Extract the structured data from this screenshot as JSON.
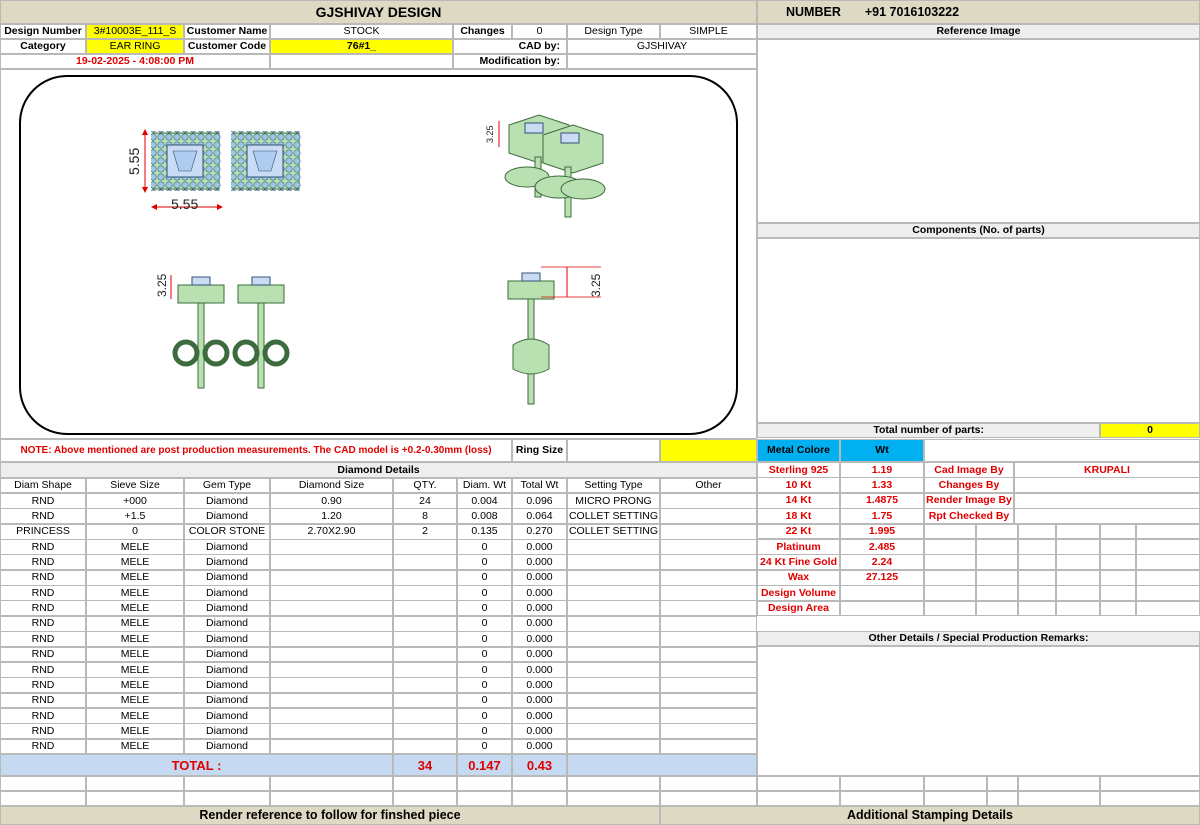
{
  "header": {
    "title": "GJSHIVAY DESIGN",
    "number_label": "NUMBER",
    "number_value": "+91 7016103222"
  },
  "info": {
    "design_number_label": "Design Number",
    "design_number": "3#10003E_111_S",
    "customer_name_label": "Customer Name",
    "customer_name": "STOCK",
    "changes_label": "Changes",
    "changes": "0",
    "design_type_label": "Design Type",
    "design_type": "SIMPLE",
    "category_label": "Category",
    "category": "EAR RING",
    "customer_code_label": "Customer Code",
    "customer_code": "76#1_",
    "cad_by_label": "CAD by:",
    "cad_by": "GJSHIVAY",
    "date": "19-02-2025 - 4:08:00 PM",
    "modification_label": "Modification by:"
  },
  "drawing": {
    "dim_width": "5.55",
    "dim_height": "5.55",
    "dim_side": "3.25",
    "dim_front": "3.25",
    "dim_persp": "3.25"
  },
  "right_panel": {
    "reference_image_label": "Reference Image",
    "components_label": "Components (No. of parts)",
    "total_parts_label": "Total number of parts:",
    "total_parts": "0",
    "other_details_label": "Other Details / Special Production Remarks:",
    "additional_stamping": "Additional Stamping Details"
  },
  "note": {
    "text": "NOTE: Above mentioned are post production measurements. The CAD model is +0.2-0.30mm (loss)",
    "ring_size_label": "Ring Size"
  },
  "diamond": {
    "section_title": "Diamond Details",
    "headers": [
      "Diam Shape",
      "Sieve Size",
      "Gem Type",
      "Diamond Size",
      "QTY.",
      "Diam. Wt",
      "Total Wt",
      "Setting Type",
      "Other"
    ],
    "rows": [
      [
        "RND",
        "+000",
        "Diamond",
        "0.90",
        "24",
        "0.004",
        "0.096",
        "MICRO PRONG",
        ""
      ],
      [
        "RND",
        "+1.5",
        "Diamond",
        "1.20",
        "8",
        "0.008",
        "0.064",
        "COLLET SETTING",
        ""
      ],
      [
        "PRINCESS",
        "0",
        "COLOR STONE",
        "2.70X2.90",
        "2",
        "0.135",
        "0.270",
        "COLLET SETTING",
        ""
      ],
      [
        "RND",
        "MELE",
        "Diamond",
        "",
        "",
        "0",
        "0.000",
        "",
        ""
      ],
      [
        "RND",
        "MELE",
        "Diamond",
        "",
        "",
        "0",
        "0.000",
        "",
        ""
      ],
      [
        "RND",
        "MELE",
        "Diamond",
        "",
        "",
        "0",
        "0.000",
        "",
        ""
      ],
      [
        "RND",
        "MELE",
        "Diamond",
        "",
        "",
        "0",
        "0.000",
        "",
        ""
      ],
      [
        "RND",
        "MELE",
        "Diamond",
        "",
        "",
        "0",
        "0.000",
        "",
        ""
      ],
      [
        "RND",
        "MELE",
        "Diamond",
        "",
        "",
        "0",
        "0.000",
        "",
        ""
      ],
      [
        "RND",
        "MELE",
        "Diamond",
        "",
        "",
        "0",
        "0.000",
        "",
        ""
      ],
      [
        "RND",
        "MELE",
        "Diamond",
        "",
        "",
        "0",
        "0.000",
        "",
        ""
      ],
      [
        "RND",
        "MELE",
        "Diamond",
        "",
        "",
        "0",
        "0.000",
        "",
        ""
      ],
      [
        "RND",
        "MELE",
        "Diamond",
        "",
        "",
        "0",
        "0.000",
        "",
        ""
      ],
      [
        "RND",
        "MELE",
        "Diamond",
        "",
        "",
        "0",
        "0.000",
        "",
        ""
      ],
      [
        "RND",
        "MELE",
        "Diamond",
        "",
        "",
        "0",
        "0.000",
        "",
        ""
      ],
      [
        "RND",
        "MELE",
        "Diamond",
        "",
        "",
        "0",
        "0.000",
        "",
        ""
      ],
      [
        "RND",
        "MELE",
        "Diamond",
        "",
        "",
        "0",
        "0.000",
        "",
        ""
      ]
    ],
    "total_label": "TOTAL :",
    "total_qty": "34",
    "total_diam_wt": "0.147",
    "total_wt": "0.43"
  },
  "metal": {
    "metal_label": "Metal Colore",
    "wt_label": "Wt",
    "rows": [
      {
        "name": "Sterling 925",
        "wt": "1.19"
      },
      {
        "name": "10 Kt",
        "wt": "1.33"
      },
      {
        "name": "14 Kt",
        "wt": "1.4875"
      },
      {
        "name": "18 Kt",
        "wt": "1.75"
      },
      {
        "name": "22 Kt",
        "wt": "1.995"
      },
      {
        "name": "Platinum",
        "wt": "2.485"
      },
      {
        "name": "24 Kt Fine Gold",
        "wt": "2.24"
      },
      {
        "name": "Wax",
        "wt": "27.125"
      },
      {
        "name": "Design Volume",
        "wt": ""
      },
      {
        "name": "Design Area",
        "wt": ""
      }
    ],
    "people": [
      {
        "label": "Cad Image By",
        "value": "KRUPALI"
      },
      {
        "label": "Changes By",
        "value": ""
      },
      {
        "label": "Render Image By",
        "value": ""
      },
      {
        "label": "Rpt Checked By",
        "value": ""
      }
    ]
  },
  "footer": {
    "render_reference": "Render reference to follow for finshed piece"
  }
}
